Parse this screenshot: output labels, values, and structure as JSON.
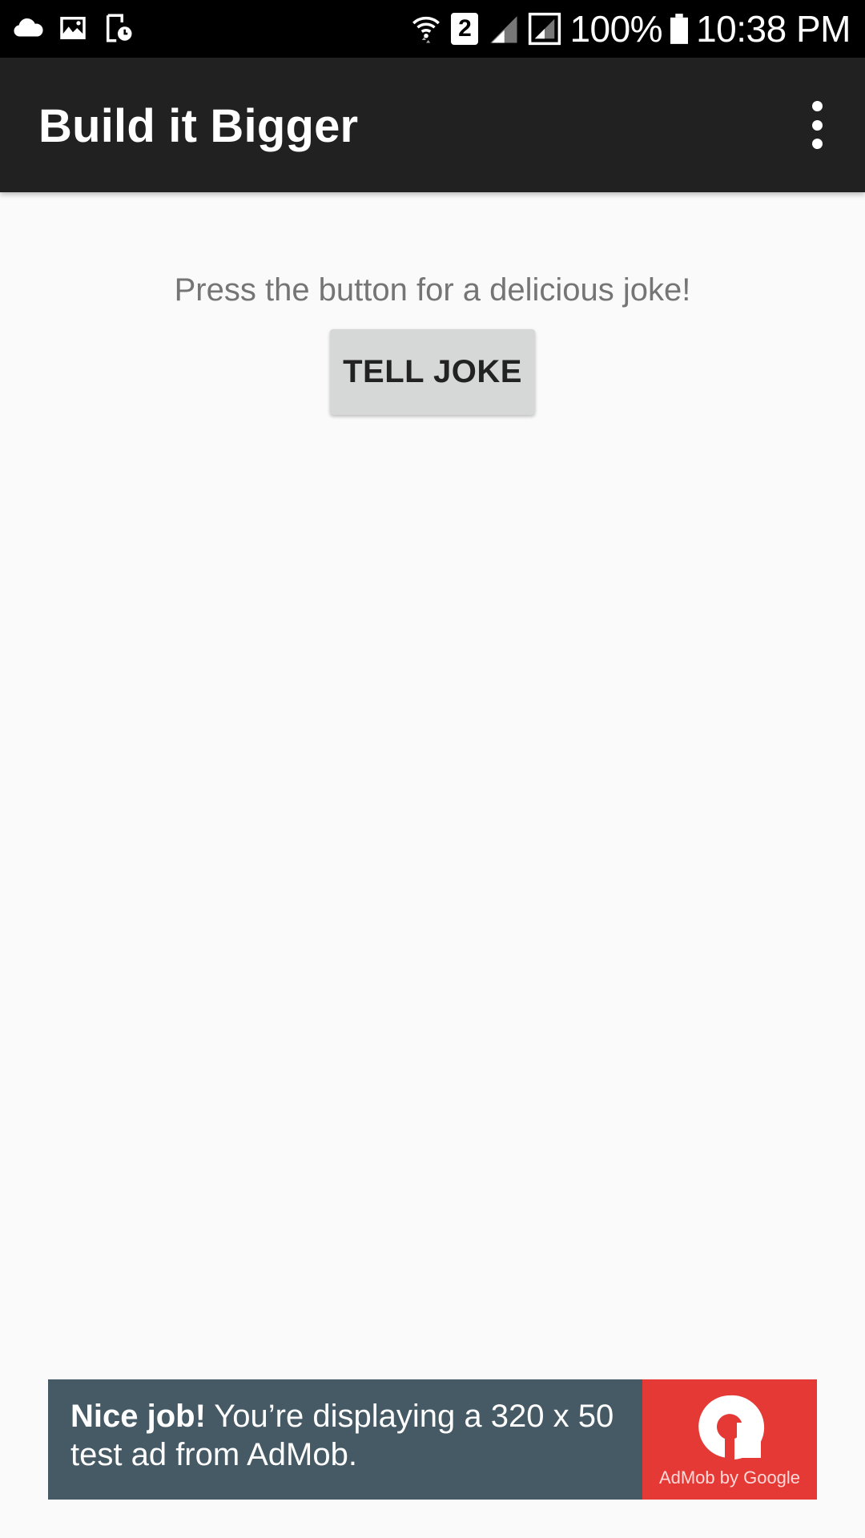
{
  "status_bar": {
    "battery": "100%",
    "time": "10:38 PM",
    "sim_badge": "2",
    "icons": [
      "cloud-icon",
      "gallery-icon",
      "screen-time-icon",
      "wifi-icon",
      "sim-icon",
      "signal-icon",
      "signal-boxed-icon",
      "battery-icon"
    ]
  },
  "app_bar": {
    "title": "Build it Bigger",
    "menu_icon": "overflow-menu-icon"
  },
  "main": {
    "instructions": "Press the button for a delicious joke!",
    "tell_joke_label": "TELL JOKE"
  },
  "ad": {
    "headline": "Nice job!",
    "body": " You’re displaying a 320 x 50 test ad from AdMob.",
    "brand": "AdMob by Google",
    "colors": {
      "background": "#455a64",
      "logo_panel": "#e53935"
    }
  },
  "colors": {
    "app_bar": "#212121",
    "background": "#fafafa",
    "button": "#d6d7d7",
    "instructions_text": "#757575"
  }
}
